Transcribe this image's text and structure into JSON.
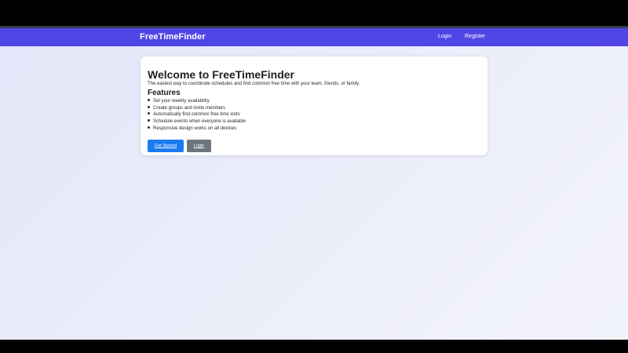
{
  "navbar": {
    "brand": "FreeTimeFinder",
    "links": [
      {
        "label": "Login"
      },
      {
        "label": "Register"
      }
    ],
    "color": "#5046e5"
  },
  "hero": {
    "title": "Welcome to FreeTimeFinder",
    "tagline": "The easiest way to coordinate schedules and find common free time with your team, friends, or family.",
    "features_heading": "Features",
    "features": [
      "Set your weekly availability",
      "Create groups and invite members",
      "Automatically find common free time slots",
      "Schedule events when everyone is available",
      "Responsive design works on all devices"
    ],
    "primary_button": "Get Started",
    "secondary_button": "Login"
  },
  "colors": {
    "primary_button": "#1a7bf0",
    "secondary_button": "#6c757d"
  }
}
